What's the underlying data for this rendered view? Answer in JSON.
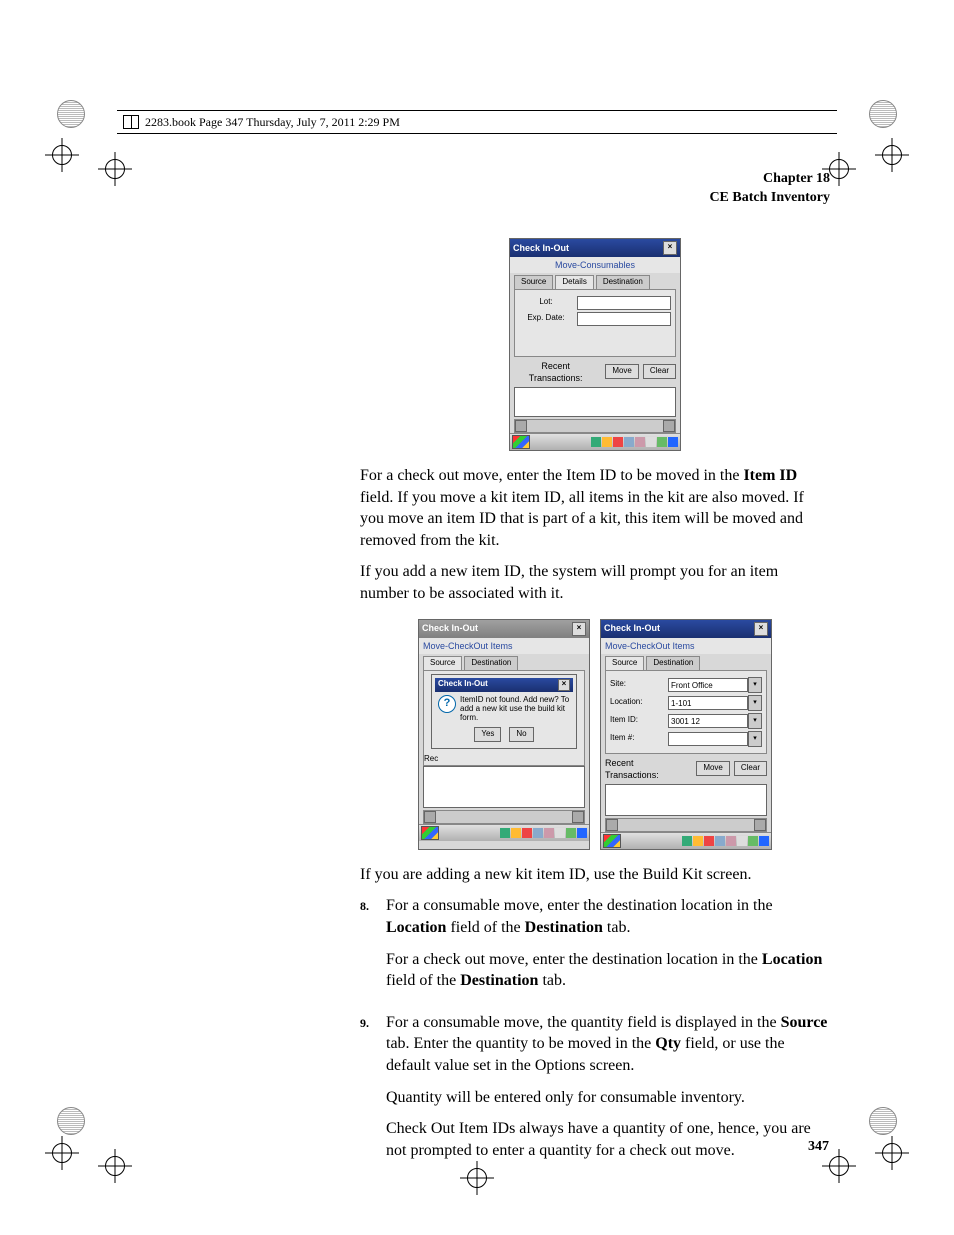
{
  "runhead": "2283.book  Page 347  Thursday, July 7, 2011  2:29 PM",
  "header": {
    "line1": "Chapter 18",
    "line2": "CE Batch Inventory"
  },
  "shot1": {
    "title": "Check In-Out",
    "link": "Move-Consumables",
    "tabs": [
      "Source",
      "Details",
      "Destination"
    ],
    "lot_label": "Lot:",
    "exp_label": "Exp. Date:",
    "recent_label": "Recent Transactions:",
    "move_btn": "Move",
    "clear_btn": "Clear"
  },
  "para1_a": "For a check out move, enter the Item ID to be moved in the ",
  "para1_bold": "Item ID",
  "para1_b": " field. If you move a kit item ID, all items in the kit are also moved. If you move an item ID that is part of a kit, this item will be moved and removed from the kit.",
  "para2": "If you add a new item ID, the system will prompt you for an item number to be associated with it.",
  "shot2": {
    "title": "Check In-Out",
    "link": "Move-CheckOut Items",
    "tabs": [
      "Source",
      "Destination"
    ],
    "msg_title": "Check In-Out",
    "msg_text": "ItemID not found. Add new? To add a new kit use the build kit form.",
    "yes": "Yes",
    "no": "No",
    "recent_label": "Rec"
  },
  "shot3": {
    "title": "Check In-Out",
    "link": "Move-CheckOut Items",
    "tabs": [
      "Source",
      "Destination"
    ],
    "site_label": "Site:",
    "site_val": "Front Office",
    "loc_label": "Location:",
    "loc_val": "1-101",
    "item_label": "Item ID:",
    "item_val": "3001 12",
    "itemno_label": "Item #:",
    "recent_label": "Recent Transactions:",
    "move_btn": "Move",
    "clear_btn": "Clear"
  },
  "para3": "If you are adding a new kit item ID, use the Build Kit screen.",
  "step8": {
    "num": "8.",
    "a": "For a consumable move, enter the destination location in the ",
    "b1": "Location",
    "c": " field of the ",
    "b2": "Destination",
    "d": " tab.",
    "p2a": "For a check out move, enter the destination location in the ",
    "p2b1": "Location",
    "p2c": " field of the ",
    "p2b2": "Destination",
    "p2d": " tab."
  },
  "step9": {
    "num": "9.",
    "a": "For a consumable move, the quantity field is displayed in the ",
    "b1": "Source",
    "c": " tab. Enter the quantity to be moved in the ",
    "b2": "Qty",
    "d": " field, or use the default value set in the Options screen.",
    "p2": "Quantity will be entered only for consumable inventory.",
    "p3": "Check Out Item IDs always have a quantity of one, hence, you are not prompted to enter a quantity for a check out move."
  },
  "page_number": "347"
}
